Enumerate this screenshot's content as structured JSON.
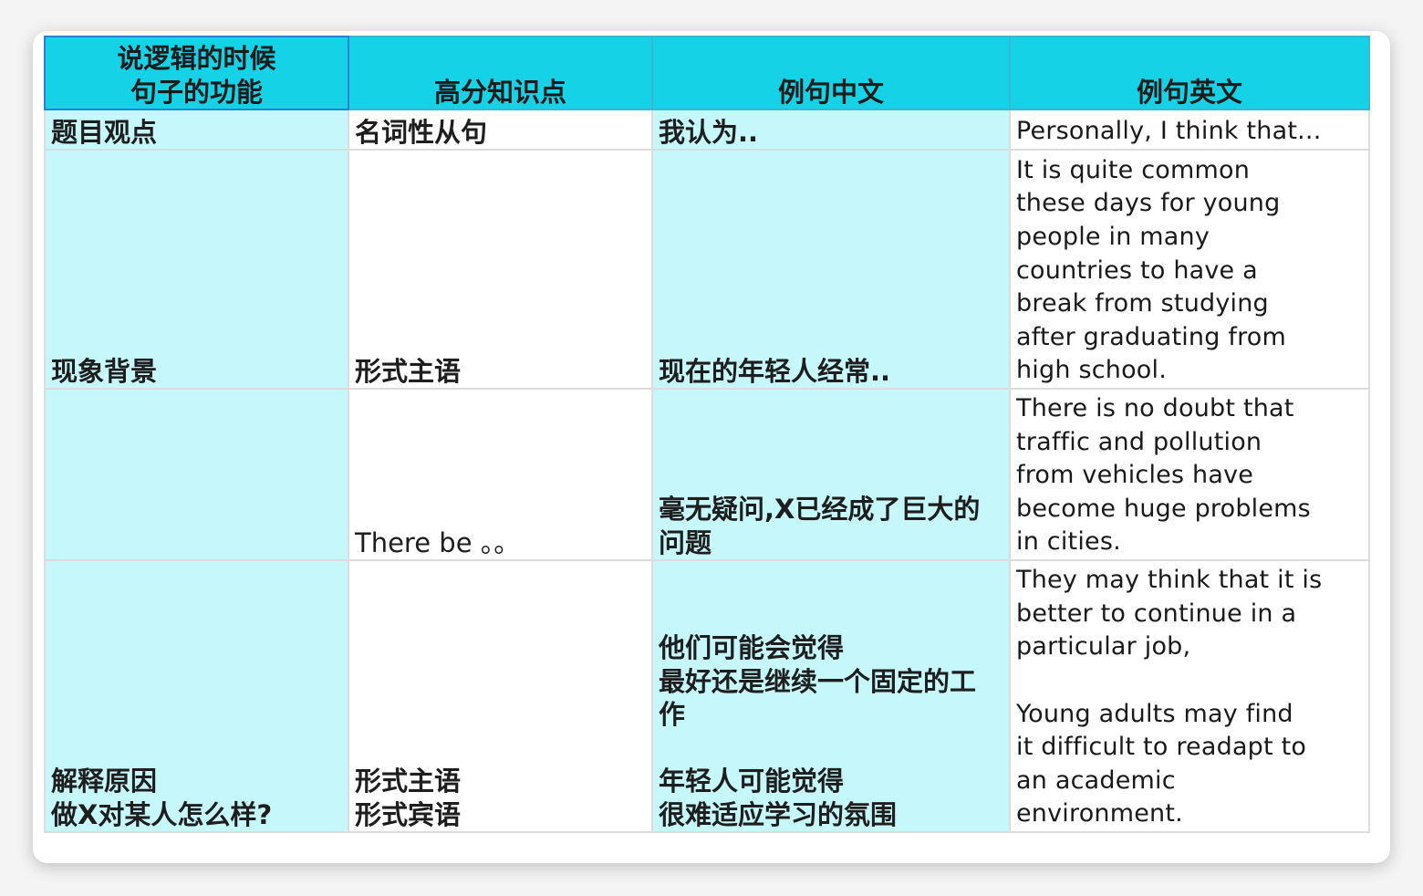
{
  "table": {
    "headers": [
      "说逻辑的时候\n句子的功能",
      "高分知识点",
      "例句中文",
      "例句英文"
    ],
    "rows": [
      {
        "function": "题目观点",
        "point": "名词性从句",
        "chinese": "我认为..",
        "english": "Personally, I think that..."
      },
      {
        "function": "现象背景",
        "point": "形式主语",
        "chinese": "现在的年轻人经常..",
        "english": "It is quite common\nthese days for young\npeople in many\ncountries to have a\nbreak from studying\nafter graduating from\nhigh school."
      },
      {
        "function": "",
        "point": "There be 。。",
        "chinese": "毫无疑问,X已经成了巨大的\n问题",
        "english": "There is no doubt that\ntraffic and pollution\nfrom vehicles have\nbecome huge problems\nin cities."
      },
      {
        "function": "解释原因\n做X对某人怎么样?",
        "point": "形式主语\n形式宾语",
        "chinese": "他们可能会觉得\n最好还是继续一个固定的工\n作\n\n年轻人可能觉得\n很难适应学习的氛围",
        "english": "They may think that it is\nbetter to continue in a\nparticular job,\n\nYoung adults may find\nit difficult to readapt to\nan academic\nenvironment."
      }
    ]
  },
  "colors": {
    "header": "#16d2e6",
    "cyan_cell": "#c6f7fa",
    "white_cell": "#ffffff"
  }
}
